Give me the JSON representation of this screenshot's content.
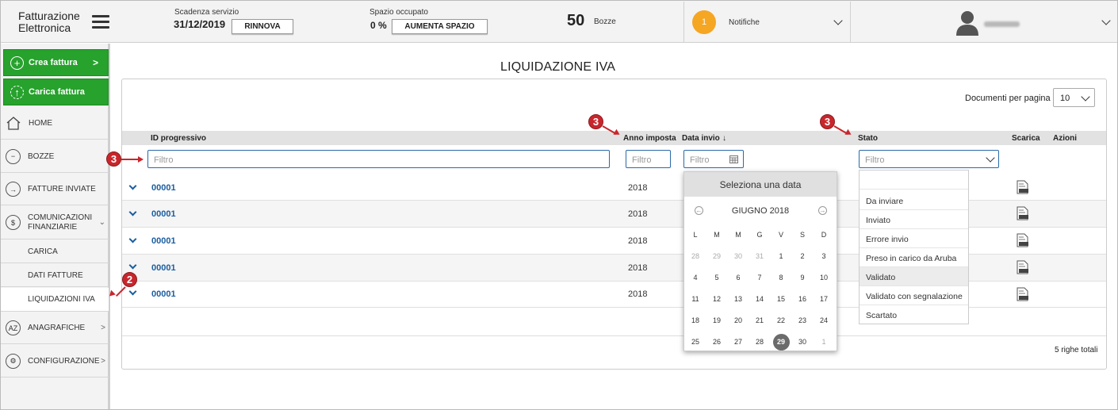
{
  "header": {
    "logo_line1": "Fatturazione",
    "logo_line2": "Elettronica",
    "service_label": "Scadenza servizio",
    "service_date": "31/12/2019",
    "renew_button": "RINNOVA",
    "space_label": "Spazio occupato",
    "space_value": "0 %",
    "space_button": "AUMENTA SPAZIO",
    "drafts_count": "50",
    "drafts_label": "Bozze",
    "notif_count": "1",
    "notif_label": "Notifiche"
  },
  "sidebar": {
    "create_button": "Crea fattura",
    "upload_button": "Carica fattura",
    "items": [
      {
        "label": "HOME",
        "icon": "home-icon"
      },
      {
        "label": "BOZZE",
        "icon": "drafts-icon"
      },
      {
        "label": "FATTURE INVIATE",
        "icon": "sent-icon"
      },
      {
        "label": "COMUNICAZIONI FINANZIARIE",
        "icon": "financial-icon"
      }
    ],
    "subitems": [
      "CARICA",
      "DATI FATTURE",
      "LIQUIDAZIONI IVA"
    ],
    "items2": [
      {
        "label": "ANAGRAFICHE",
        "icon": "registry-icon"
      },
      {
        "label": "CONFIGURAZIONE",
        "icon": "settings-icon"
      }
    ]
  },
  "main": {
    "title": "LIQUIDAZIONE IVA",
    "docs_per_page_label": "Documenti per pagina",
    "docs_per_page_value": "10",
    "columns": {
      "id": "ID progressivo",
      "year": "Anno imposta",
      "date": "Data invio",
      "sort_indicator": "↓",
      "status": "Stato",
      "download": "Scarica",
      "actions": "Azioni"
    },
    "filter_placeholder": "Filtro",
    "rows": [
      {
        "id": "00001",
        "year": "2018"
      },
      {
        "id": "00001",
        "year": "2018"
      },
      {
        "id": "00001",
        "year": "2018"
      },
      {
        "id": "00001",
        "year": "2018"
      },
      {
        "id": "00001",
        "year": "2018"
      }
    ],
    "totals": "5 righe totali"
  },
  "datepicker": {
    "header": "Seleziona una data",
    "month": "GIUGNO 2018",
    "weekdays": [
      "L",
      "M",
      "M",
      "G",
      "V",
      "S",
      "D"
    ],
    "weeks": [
      [
        "28",
        "29",
        "30",
        "31",
        "1",
        "2",
        "3"
      ],
      [
        "4",
        "5",
        "6",
        "7",
        "8",
        "9",
        "10"
      ],
      [
        "11",
        "12",
        "13",
        "14",
        "15",
        "16",
        "17"
      ],
      [
        "18",
        "19",
        "20",
        "21",
        "22",
        "23",
        "24"
      ],
      [
        "25",
        "26",
        "27",
        "28",
        "29",
        "30",
        "1"
      ]
    ],
    "selected_day": "29"
  },
  "status_dropdown": {
    "options": [
      "",
      "Da inviare",
      "Inviato",
      "Errore invio",
      "Preso in carico da Aruba",
      "Validato",
      "Validato con segnalazione",
      "Scartato"
    ],
    "highlighted": "Validato"
  },
  "annotations": [
    "3",
    "3",
    "3",
    "2"
  ],
  "colors": {
    "accent_green": "#27a22d",
    "link_blue": "#1b5ea0",
    "notif_orange": "#f5a623",
    "annotation_red": "#c8262c"
  }
}
